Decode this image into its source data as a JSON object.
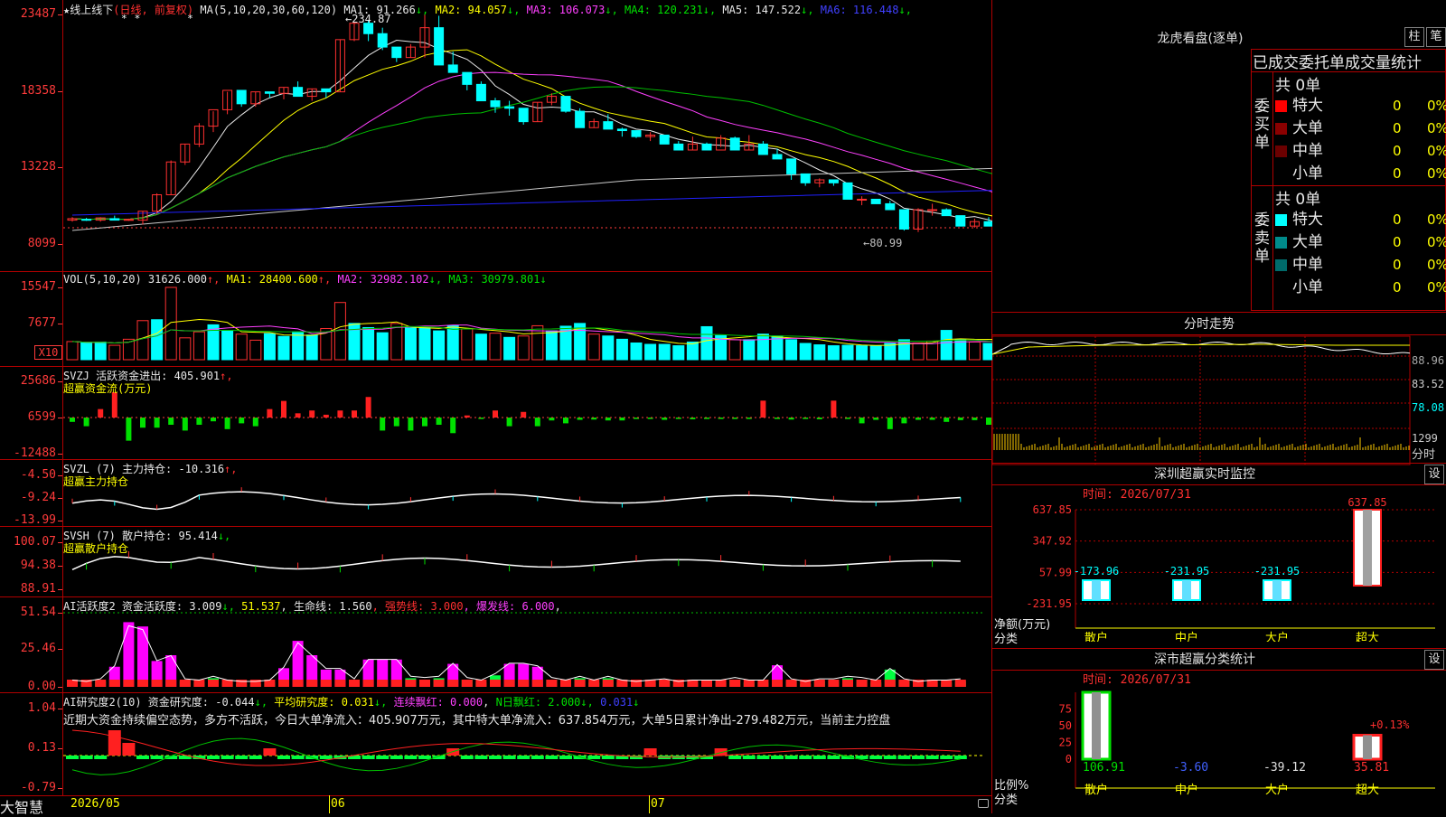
{
  "main_chart": {
    "title_star": "★",
    "title": "线上线下",
    "title_mode": "(日线, 前复权)",
    "ma_label": "MA(5,10,20,30,60,120)",
    "ma_values": [
      {
        "label": "MA1:",
        "value": "91.266",
        "arrow": "↓",
        "color": "#e8e8e8"
      },
      {
        "label": "MA2:",
        "value": "94.057",
        "arrow": "↓",
        "color": "#ffff00"
      },
      {
        "label": "MA3:",
        "value": "106.073",
        "arrow": "↓",
        "color": "#ff40ff"
      },
      {
        "label": "MA4:",
        "value": "120.231",
        "arrow": "↓",
        "color": "#00e000"
      },
      {
        "label": "MA5:",
        "value": "147.522",
        "arrow": "↓",
        "color": "#e8e8e8"
      },
      {
        "label": "MA6:",
        "value": "116.448",
        "arrow": "↓",
        "color": "#4040ff"
      }
    ],
    "y_ticks": [
      "23487",
      "18358",
      "13228",
      "8099"
    ],
    "high_annotation": "←234.87",
    "low_annotation": "←80.99",
    "x_labels": [
      "2026/05",
      "06",
      "07"
    ],
    "brand": "大智慧",
    "chart_data": {
      "type": "candlestick",
      "ylim": [
        8099,
        23487
      ],
      "candles": [
        [
          9700,
          9900,
          9600,
          9800
        ],
        [
          9750,
          9850,
          9650,
          9700
        ],
        [
          9700,
          9900,
          9600,
          9850
        ],
        [
          9800,
          10000,
          9700,
          9700
        ],
        [
          9700,
          9800,
          9650,
          9750
        ],
        [
          9700,
          10300,
          9400,
          10300
        ],
        [
          10300,
          11500,
          10100,
          11400
        ],
        [
          11400,
          13700,
          11400,
          13600
        ],
        [
          13600,
          14800,
          13400,
          14800
        ],
        [
          14800,
          16200,
          14600,
          16000
        ],
        [
          16000,
          17000,
          15600,
          17100
        ],
        [
          17100,
          18300,
          16800,
          18400
        ],
        [
          18400,
          18400,
          17300,
          17500
        ],
        [
          17500,
          18300,
          17300,
          18300
        ],
        [
          18300,
          18300,
          17900,
          18200
        ],
        [
          18200,
          18600,
          17800,
          18600
        ],
        [
          18600,
          19000,
          18300,
          18000
        ],
        [
          18000,
          18500,
          17700,
          18500
        ],
        [
          18500,
          18500,
          17900,
          18300
        ],
        [
          18300,
          21800,
          18300,
          21800
        ],
        [
          21800,
          23000,
          21700,
          22900
        ],
        [
          22900,
          23100,
          21700,
          22200
        ],
        [
          22200,
          22600,
          21100,
          21300
        ],
        [
          21300,
          21200,
          20300,
          20600
        ],
        [
          20600,
          21500,
          20600,
          21300
        ],
        [
          21300,
          23487,
          20600,
          22600
        ],
        [
          22600,
          23400,
          21600,
          20100
        ],
        [
          20100,
          21000,
          19700,
          19600
        ],
        [
          19600,
          19300,
          18400,
          18800
        ],
        [
          18800,
          19000,
          17700,
          17700
        ],
        [
          17700,
          17900,
          16900,
          17300
        ],
        [
          17300,
          17700,
          16700,
          17200
        ],
        [
          17200,
          17000,
          16100,
          16300
        ],
        [
          16300,
          17600,
          16300,
          17600
        ],
        [
          17600,
          18200,
          17400,
          18000
        ],
        [
          18000,
          17900,
          16900,
          17000
        ],
        [
          17000,
          17200,
          15900,
          15900
        ],
        [
          15900,
          16500,
          15900,
          16300
        ],
        [
          16300,
          16800,
          15900,
          15800
        ],
        [
          15800,
          15900,
          15300,
          15700
        ],
        [
          15700,
          15700,
          15200,
          15300
        ],
        [
          15300,
          15600,
          15000,
          15400
        ],
        [
          15400,
          15300,
          14800,
          14800
        ],
        [
          14800,
          15000,
          14400,
          14400
        ],
        [
          14400,
          15300,
          14400,
          14800
        ],
        [
          14800,
          14900,
          14600,
          14400
        ],
        [
          14400,
          15400,
          14600,
          15200
        ],
        [
          15200,
          15300,
          14600,
          14400
        ],
        [
          14400,
          15400,
          14400,
          14800
        ],
        [
          14800,
          15000,
          14200,
          14100
        ],
        [
          14100,
          14500,
          13800,
          13800
        ],
        [
          13800,
          13800,
          12400,
          12800
        ],
        [
          12800,
          12800,
          12000,
          12200
        ],
        [
          12200,
          12500,
          11900,
          12400
        ],
        [
          12400,
          12400,
          12000,
          12200
        ],
        [
          12200,
          12200,
          11500,
          11100
        ],
        [
          11100,
          11300,
          10700,
          11100
        ],
        [
          11100,
          11100,
          10800,
          10800
        ],
        [
          10800,
          11000,
          10400,
          10400
        ],
        [
          10400,
          10400,
          9000,
          9100
        ],
        [
          9100,
          10500,
          8900,
          10400
        ],
        [
          10400,
          10800,
          10000,
          10400
        ],
        [
          10400,
          10500,
          10100,
          10000
        ],
        [
          10000,
          10000,
          9300,
          9300
        ],
        [
          9300,
          9800,
          9200,
          9600
        ],
        [
          9600,
          9900,
          9300,
          9300
        ],
        [
          9300,
          9300,
          8900,
          8800
        ],
        [
          8800,
          8900,
          8700,
          8700
        ],
        [
          8700,
          8800,
          8500,
          8400
        ],
        [
          8400,
          8600,
          8300,
          8600
        ]
      ]
    }
  },
  "vol_panel": {
    "header": [
      {
        "text": "VOL(5,10,20) ",
        "color": "#e8e8e8"
      },
      {
        "text": "31626.000",
        "color": "#e8e8e8"
      },
      {
        "text": "↑, ",
        "color": "#ff3030"
      },
      {
        "text": "MA1: 28400.600",
        "color": "#ffff00"
      },
      {
        "text": "↑, ",
        "color": "#ff3030"
      },
      {
        "text": "MA2: 32982.102",
        "color": "#ff40ff"
      },
      {
        "text": "↓, ",
        "color": "#00e000"
      },
      {
        "text": "MA3: 30979.801",
        "color": "#00e000"
      },
      {
        "text": "↓",
        "color": "#00e000"
      }
    ],
    "y_ticks": [
      "15547",
      "7677"
    ],
    "unit_badge": "X10",
    "chart_data": {
      "type": "bar",
      "ylim": [
        0,
        15547
      ],
      "values": [
        3900,
        3600,
        3800,
        3100,
        4400,
        8400,
        8600,
        15547,
        4700,
        6000,
        7500,
        6300,
        5500,
        4200,
        5600,
        5000,
        6000,
        5300,
        6700,
        12300,
        7800,
        6900,
        5800,
        7800,
        6800,
        7000,
        6200,
        7300,
        6600,
        5500,
        5700,
        4800,
        5100,
        7300,
        6200,
        7200,
        7800,
        5500,
        5100,
        4400,
        3600,
        3300,
        3300,
        3000,
        3800,
        7100,
        5200,
        4300,
        4300,
        5500,
        5100,
        4300,
        3500,
        3200,
        3000,
        3100,
        3000,
        3000,
        3500,
        4300,
        3600,
        4000,
        6300,
        4300,
        3800,
        3500,
        3300,
        3200,
        3400,
        3000
      ],
      "up": [
        1,
        0,
        0,
        1,
        1,
        1,
        0,
        1,
        1,
        1,
        0,
        0,
        1,
        1,
        0,
        0,
        0,
        0,
        1,
        1,
        0,
        0,
        0,
        1,
        0,
        0,
        0,
        0,
        1,
        0,
        1,
        0,
        1,
        1,
        0,
        0,
        0,
        1,
        0,
        0,
        0,
        0,
        0,
        0,
        0,
        0,
        0,
        1,
        0,
        0,
        0,
        0,
        0,
        0,
        0,
        0,
        0,
        0,
        0,
        0,
        1,
        1,
        0,
        0,
        1,
        0,
        0,
        0,
        0,
        1
      ]
    }
  },
  "svzj_panel": {
    "header1": "SVZJ  活跃资金进出: 405.901",
    "header1_arrow": "↑,",
    "header2": "超赢资金流(万元)",
    "y_ticks": [
      "25686",
      "6599",
      "-12488"
    ],
    "chart_data": {
      "type": "bar",
      "ylim": [
        -12488,
        25686
      ],
      "values": [
        -1500,
        -3000,
        6000,
        18000,
        -8000,
        -3500,
        -3500,
        -2500,
        -4500,
        -2500,
        -1300,
        -4000,
        -2000,
        -3000,
        6000,
        11800,
        3000,
        5000,
        2000,
        5000,
        5000,
        14600,
        -4500,
        -3000,
        -4500,
        -3000,
        -2500,
        -5400,
        1500,
        -500,
        5000,
        -3000,
        4000,
        -3000,
        -1000,
        -2000,
        -800,
        -700,
        -1000,
        -1000,
        -500,
        -500,
        -800,
        -500,
        -600,
        -500,
        -500,
        -500,
        -500,
        12000,
        -500,
        -700,
        -500,
        -600,
        12000,
        -500,
        -2000,
        -800,
        -4000,
        -2000,
        -800,
        -800,
        -1500,
        -900,
        -900,
        -2500,
        -800,
        2200,
        2000,
        -500,
        -500,
        -600,
        -500,
        -500,
        -500,
        -500,
        -500,
        -500,
        -500
      ]
    }
  },
  "svzl_panel": {
    "header1": "SVZL (7) 主力持仓: -10.316",
    "header1_arrow": "↑,",
    "header2": "超赢主力持仓",
    "y_ticks": [
      "-4.50",
      "-9.24",
      "-13.99"
    ]
  },
  "svsh_panel": {
    "header1": "SVSH (7) 散户持仓: 95.414",
    "header1_arrow": "↓,",
    "header2": "超赢散户持仓",
    "y_ticks": [
      "100.07",
      "94.38",
      "88.91"
    ]
  },
  "ai_huoyue_panel": {
    "header": [
      {
        "text": "AI活跃度2 资金活跃度: 3.009",
        "color": "#e8e8e8"
      },
      {
        "text": "↓, ",
        "color": "#00e000"
      },
      {
        "text": "51.537",
        "color": "#ffff00"
      },
      {
        "text": ", 生命线: 1.560",
        "color": "#e8e8e8"
      },
      {
        "text": ", 强势线: 3.000",
        "color": "#ff3030"
      },
      {
        "text": ", 爆发线: 6.000",
        "color": "#ff40ff"
      },
      {
        "text": ",",
        "color": "#e8e8e8"
      }
    ],
    "y_ticks": [
      "51.54",
      "25.46",
      "0.00"
    ],
    "chart_data": {
      "type": "bar",
      "ylim": [
        0,
        51.54
      ],
      "values": [
        3,
        2,
        4,
        14,
        45,
        42,
        18,
        22,
        4,
        3,
        6,
        3,
        2,
        2,
        3,
        13,
        32,
        22,
        12,
        12,
        4,
        19,
        19,
        19,
        6,
        5,
        6,
        16,
        5,
        3,
        8,
        16,
        16,
        14,
        5,
        3,
        6,
        3,
        6,
        3,
        2,
        3,
        4,
        2,
        3,
        3,
        3,
        5,
        3,
        3,
        15,
        4,
        2,
        4,
        4,
        6,
        5,
        3,
        12,
        4,
        2,
        3,
        3,
        4,
        3,
        4,
        3,
        8,
        4,
        5,
        4,
        3,
        3,
        3,
        3,
        3,
        3,
        3,
        3,
        3,
        3,
        3,
        3,
        3,
        3
      ],
      "magenta": [
        0,
        0,
        0,
        1,
        1,
        1,
        1,
        1,
        0,
        0,
        0,
        0,
        0,
        0,
        0,
        1,
        1,
        1,
        1,
        1,
        0,
        1,
        1,
        1,
        0,
        0,
        0,
        1,
        0,
        0,
        0,
        1,
        1,
        1,
        0,
        0,
        0,
        0,
        0,
        0,
        0,
        0,
        0,
        0,
        0,
        0,
        0,
        0,
        0,
        0,
        1,
        0,
        0,
        0,
        0,
        0,
        0,
        0,
        0,
        0,
        0,
        0,
        0,
        0,
        0,
        0,
        0,
        0,
        0,
        0,
        0,
        0,
        0,
        0,
        0,
        0,
        0,
        0,
        0,
        0,
        0,
        0,
        0,
        0,
        0
      ]
    }
  },
  "ai_yanjiu_panel": {
    "header": [
      {
        "text": "AI研究度2(10) 资金研究度: -0.044",
        "color": "#e8e8e8"
      },
      {
        "text": "↓, ",
        "color": "#00e000"
      },
      {
        "text": "平均研究度: 0.031",
        "color": "#ffff00"
      },
      {
        "text": "↓, ",
        "color": "#00e000"
      },
      {
        "text": "连续飘红: 0.000",
        "color": "#ff40ff"
      },
      {
        "text": ", ",
        "color": "#e8e8e8"
      },
      {
        "text": "N日飘红: 2.000",
        "color": "#00e000"
      },
      {
        "text": "↓, ",
        "color": "#00e000"
      },
      {
        "text": "0.031",
        "color": "#4040ff"
      },
      {
        "text": "↓",
        "color": "#00e000"
      }
    ],
    "comment": "近期大资金持续偏空态势，多方不活跃，今日大单净流入：405.907万元，其中特大单净流入：637.854万元，大单5日累计净出-279.482万元，当前主力控盘",
    "y_ticks": [
      "1.04",
      "0.13",
      "-0.79"
    ]
  },
  "longhu": {
    "title": "龙虎看盘(逐单)",
    "btn1": "柱",
    "btn2": "笔",
    "tabs": "已成交委托单成交量统计",
    "buy_side_label": "委买单",
    "sell_side_label": "委卖单",
    "buy_total": "共 0单",
    "sell_total": "共 0单",
    "buy_rows": [
      {
        "label": "特大",
        "count": "0",
        "pct": "0%",
        "color": "#ff0000"
      },
      {
        "label": "大单",
        "count": "0",
        "pct": "0%",
        "color": "#8b0000"
      },
      {
        "label": "中单",
        "count": "0",
        "pct": "0%",
        "color": "#6b0000"
      },
      {
        "label": "小单",
        "count": "0",
        "pct": "0%",
        "color": "#000000"
      }
    ],
    "sell_rows": [
      {
        "label": "特大",
        "count": "0",
        "pct": "0%",
        "color": "#00ffff"
      },
      {
        "label": "大单",
        "count": "0",
        "pct": "0%",
        "color": "#008b8b"
      },
      {
        "label": "中单",
        "count": "0",
        "pct": "0%",
        "color": "#006b6b"
      },
      {
        "label": "小单",
        "count": "0",
        "pct": "0%",
        "color": "#000000"
      }
    ]
  },
  "fenshi": {
    "title": "分时走势",
    "y_ticks": [
      "88.96",
      "83.52",
      "78.08"
    ],
    "vol_tick": "1299",
    "vol_label": "分时"
  },
  "shenzhen_monitor": {
    "title": "深圳超赢实时监控",
    "btn": "设",
    "time": "时间: 2026/07/31",
    "y_ticks": [
      "637.85",
      "347.92",
      "57.99",
      "-231.95"
    ],
    "y_label1": "净额(万元)",
    "y_label2": "分类",
    "categories": [
      "散户",
      "中户",
      "大户",
      "超大"
    ],
    "chart_data": {
      "type": "bar",
      "categories": [
        "散户",
        "中户",
        "大户",
        "超大"
      ],
      "values": [
        -173.96,
        -231.95,
        -231.95,
        637.85
      ],
      "labels": [
        "-173.96",
        "-231.95",
        "-231.95",
        "637.85"
      ],
      "ylim": [
        -231.95,
        637.85
      ]
    }
  },
  "shenshi_stats": {
    "title": "深市超赢分类统计",
    "btn": "设",
    "time": "时间: 2026/07/31",
    "y_ticks": [
      "75",
      "50",
      "25",
      "0"
    ],
    "y_label1": "比例%",
    "y_label2": "分类",
    "categories": [
      "散户",
      "中户",
      "大户",
      "超大"
    ],
    "annotation": "+0.13%",
    "chart_data": {
      "type": "bar",
      "categories": [
        "散户",
        "中户",
        "大户",
        "超大"
      ],
      "values": [
        106.91,
        -3.6,
        -39.12,
        35.81
      ],
      "labels": [
        "106.91",
        "-3.60",
        "-39.12",
        "35.81"
      ],
      "ylim": [
        0,
        100
      ]
    }
  }
}
